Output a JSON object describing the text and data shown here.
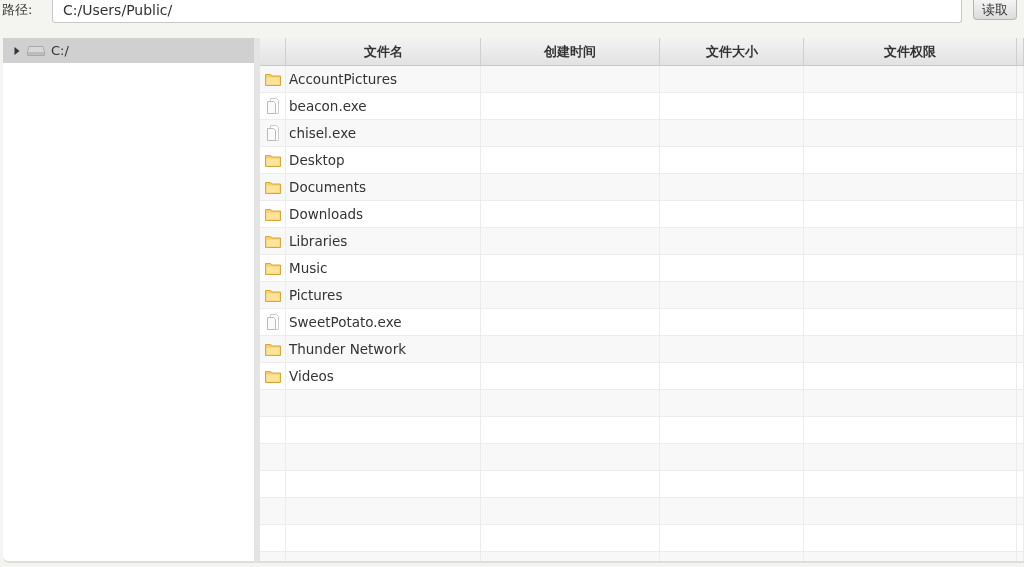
{
  "path_bar": {
    "label": "路径:",
    "value": "C:/Users/Public/",
    "button": "读取"
  },
  "tree": {
    "items": [
      {
        "label": "C:/",
        "expanded": false,
        "selected": true
      }
    ]
  },
  "table": {
    "columns": [
      "文件名",
      "创建时间",
      "文件大小",
      "文件权限"
    ],
    "rows": [
      {
        "kind": "folder",
        "name": "AccountPictures"
      },
      {
        "kind": "file",
        "name": "beacon.exe"
      },
      {
        "kind": "file",
        "name": "chisel.exe"
      },
      {
        "kind": "folder",
        "name": "Desktop"
      },
      {
        "kind": "folder",
        "name": "Documents"
      },
      {
        "kind": "folder",
        "name": "Downloads"
      },
      {
        "kind": "folder",
        "name": "Libraries"
      },
      {
        "kind": "folder",
        "name": "Music"
      },
      {
        "kind": "folder",
        "name": "Pictures"
      },
      {
        "kind": "file",
        "name": "SweetPotato.exe"
      },
      {
        "kind": "folder",
        "name": "Thunder Network"
      },
      {
        "kind": "folder",
        "name": "Videos"
      }
    ]
  }
}
